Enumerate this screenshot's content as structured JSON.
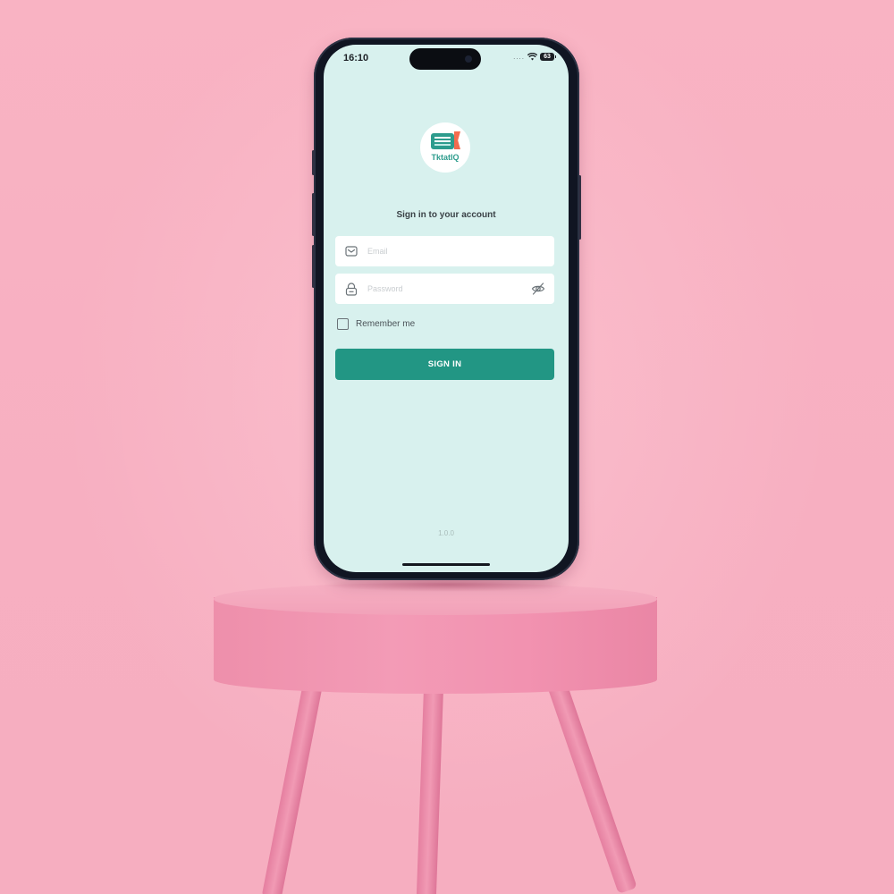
{
  "status_bar": {
    "time": "16:10",
    "signal": "....",
    "battery": "63"
  },
  "app": {
    "logo_text": "TktatIQ",
    "heading": "Sign in to your account",
    "email": {
      "placeholder": "Email",
      "value": ""
    },
    "password": {
      "placeholder": "Password",
      "value": ""
    },
    "remember_label": "Remember me",
    "remember_checked": false,
    "signin_label": "SIGN IN",
    "version": "1.0.0"
  },
  "colors": {
    "accent": "#229684",
    "screen_bg": "#d8f1ee",
    "backdrop": "#f7afc1"
  },
  "icons": {
    "email": "mail-icon",
    "password": "lock-icon",
    "toggle_visibility": "eye-off-icon",
    "wifi": "wifi-icon",
    "battery": "battery-icon"
  }
}
